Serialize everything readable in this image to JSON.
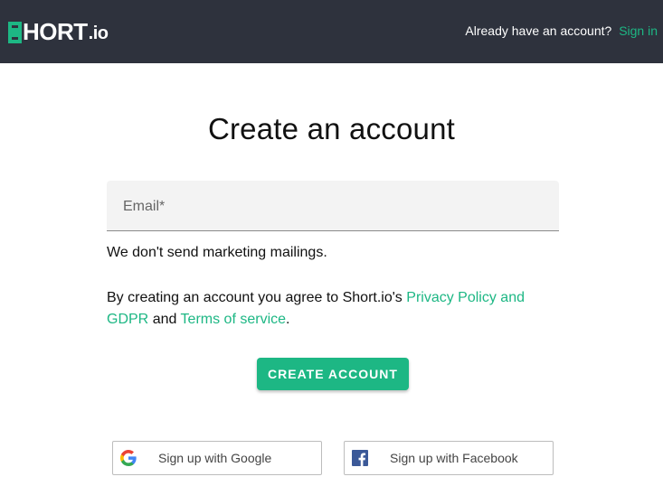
{
  "header": {
    "logo": {
      "main": "HORT",
      "suffix": ".io"
    },
    "account_prompt": "Already have an account?",
    "signin_label": "Sign in"
  },
  "main": {
    "title": "Create an account",
    "email": {
      "placeholder": "Email*",
      "value": ""
    },
    "note": "We don't send marketing mailings.",
    "agreement": {
      "prefix": "By creating an account you agree to Short.io's",
      "privacy_link": "Privacy Policy and GDPR",
      "and": "and",
      "terms_link": "Terms of service",
      "suffix": "."
    },
    "create_button": "CREATE ACCOUNT"
  },
  "social": {
    "google_label": "Sign up with Google",
    "facebook_label": "Sign up with Facebook"
  },
  "colors": {
    "header_bg": "#2e323d",
    "accent": "#1db784",
    "facebook": "#3b5998"
  }
}
